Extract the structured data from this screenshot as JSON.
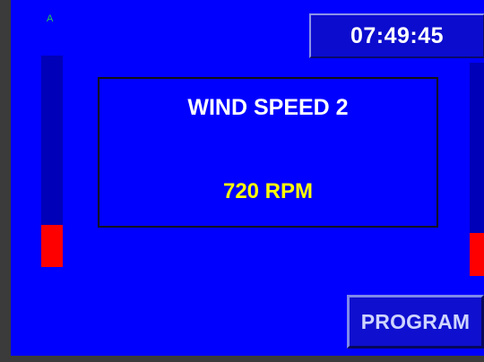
{
  "status": {
    "indicator": "A"
  },
  "clock": {
    "time": "07:49:45"
  },
  "display": {
    "title": "WIND SPEED 2",
    "value": "720 RPM"
  },
  "bars": [
    {
      "name": "left",
      "level_percent": 20,
      "fill_color": "#ff0000"
    },
    {
      "name": "right",
      "level_percent": 20,
      "fill_color": "#ff0000"
    }
  ],
  "buttons": {
    "program_label": "PROGRAM"
  },
  "colors": {
    "background": "#0000ff",
    "bar_track": "#0000b8",
    "value_text": "#ffff00",
    "indicator_text": "#22cc55"
  }
}
